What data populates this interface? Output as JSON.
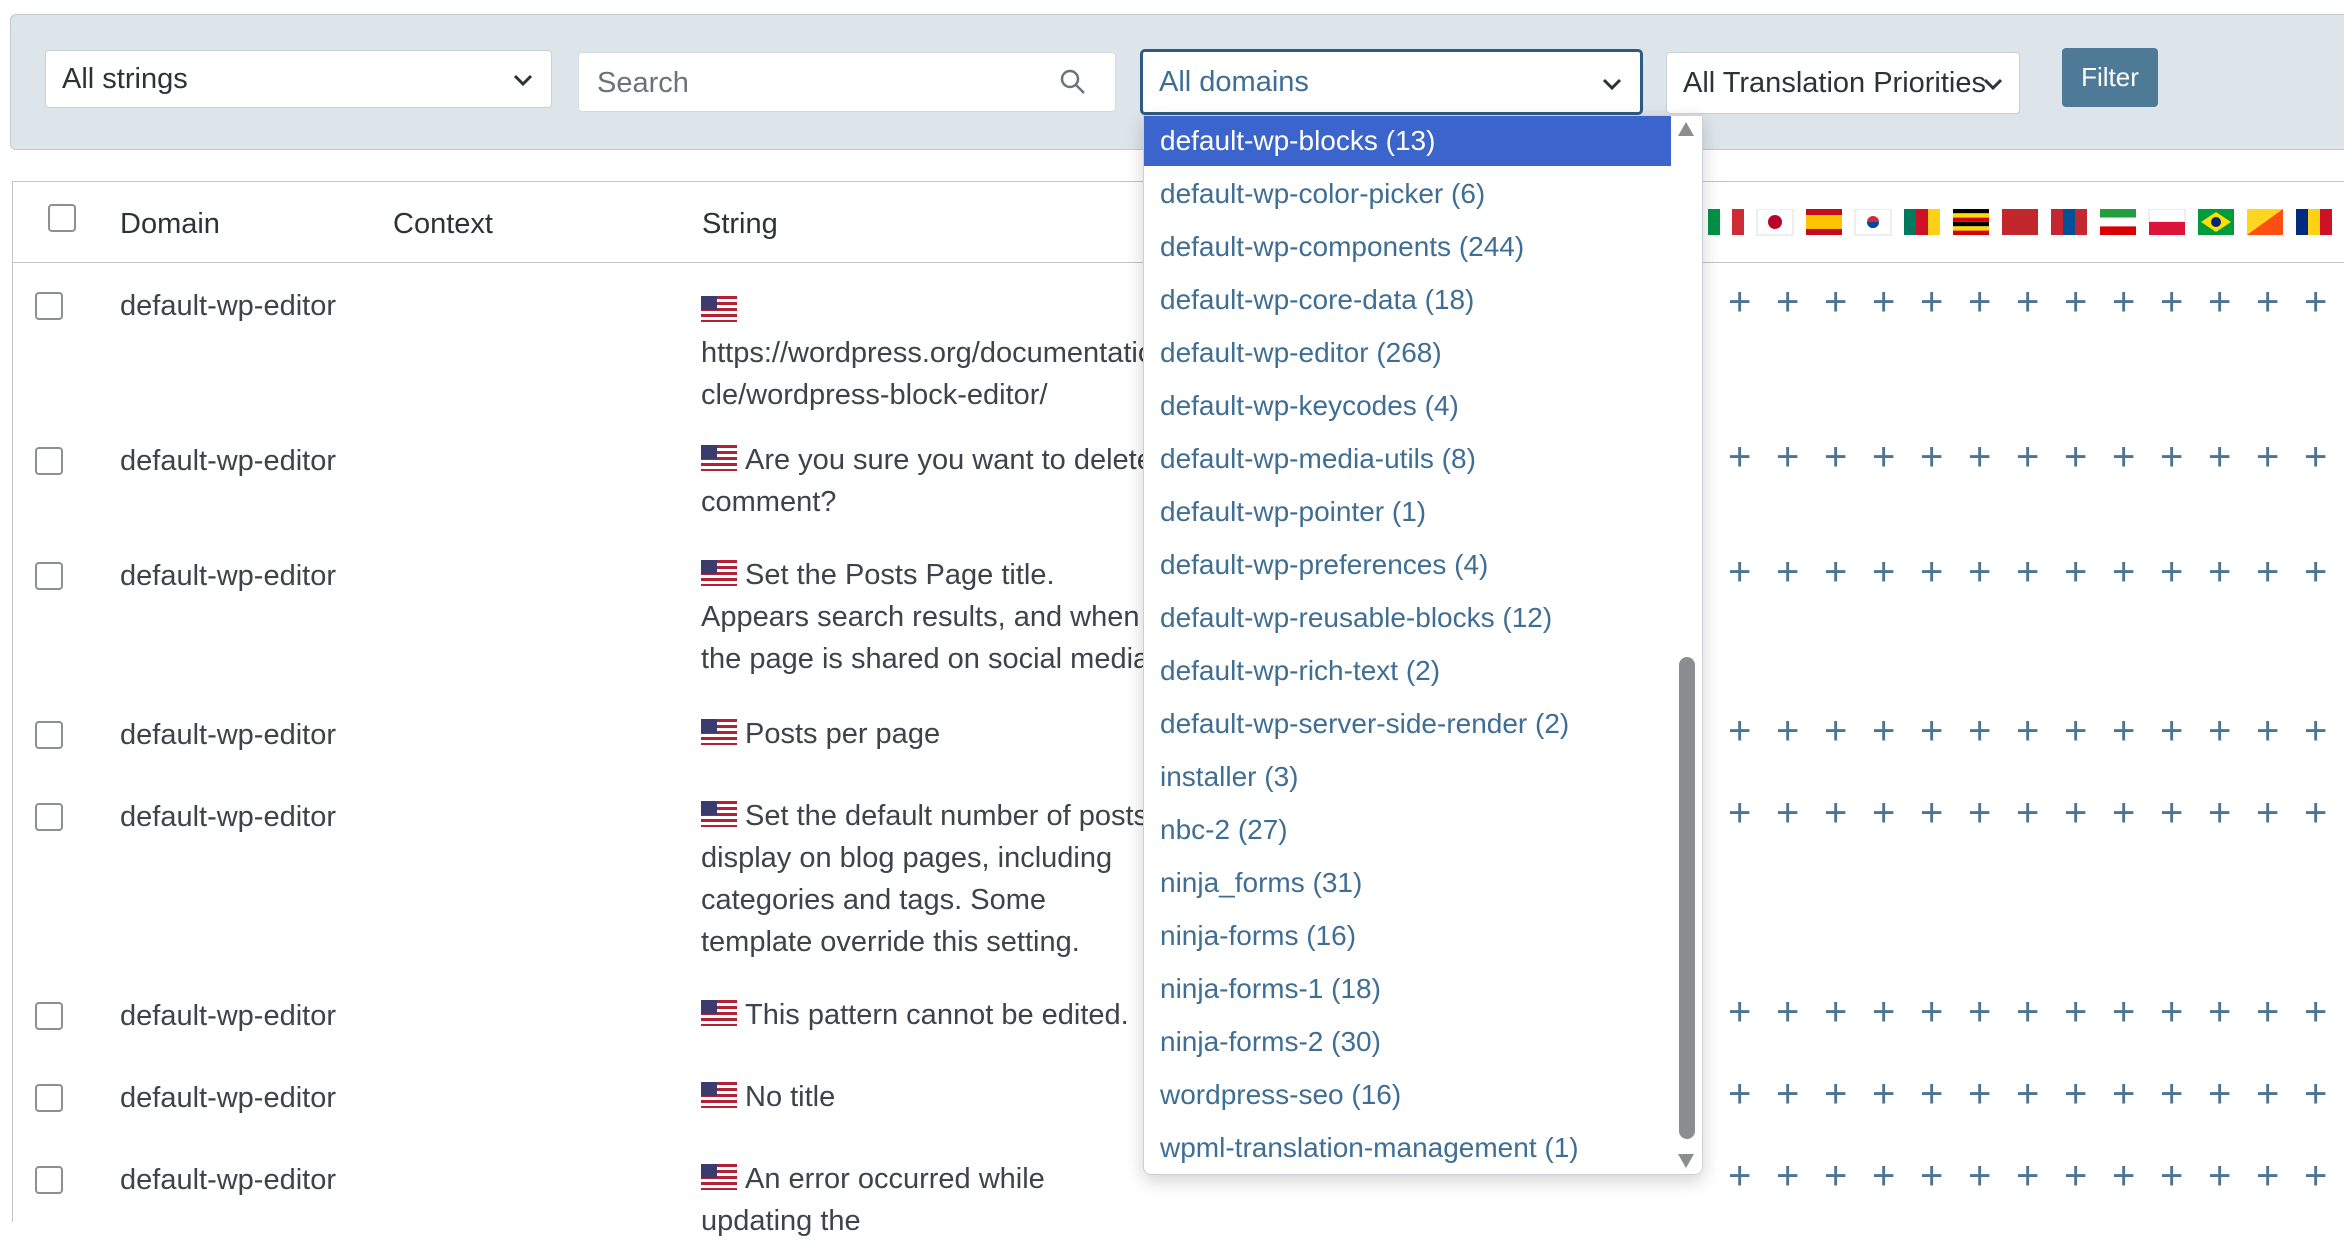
{
  "filters": {
    "strings_select": "All strings",
    "search_placeholder": "Search",
    "domains_select": "All domains",
    "priority_select": "All Translation Priorities",
    "filter_button": "Filter"
  },
  "table": {
    "headers": {
      "domain": "Domain",
      "context": "Context",
      "string": "String"
    },
    "rows": [
      {
        "domain": "default-wp-editor",
        "string": "https://wordpress.org/documentatio cle/wordpress-block-editor/"
      },
      {
        "domain": "default-wp-editor",
        "string": "Are you sure you want to delete comment?"
      },
      {
        "domain": "default-wp-editor",
        "string": "Set the Posts Page title. Appears search results, and when the page is shared on social media."
      },
      {
        "domain": "default-wp-editor",
        "string": "Posts per page"
      },
      {
        "domain": "default-wp-editor",
        "string": "Set the default number of posts display on blog pages, including categories and tags. Some template override this setting."
      },
      {
        "domain": "default-wp-editor",
        "string": "This pattern cannot be edited."
      },
      {
        "domain": "default-wp-editor",
        "string": "No title"
      },
      {
        "domain": "default-wp-editor",
        "string": "An error occurred while updating the"
      }
    ]
  },
  "dropdown": {
    "items": [
      "default-wp-blocks (13)",
      "default-wp-color-picker (6)",
      "default-wp-components (244)",
      "default-wp-core-data (18)",
      "default-wp-editor (268)",
      "default-wp-keycodes (4)",
      "default-wp-media-utils (8)",
      "default-wp-pointer (1)",
      "default-wp-preferences (4)",
      "default-wp-reusable-blocks (12)",
      "default-wp-rich-text (2)",
      "default-wp-server-side-render (2)",
      "installer (3)",
      "nbc-2 (27)",
      "ninja_forms (31)",
      "ninja-forms (16)",
      "ninja-forms-1 (18)",
      "ninja-forms-2 (30)",
      "wordpress-seo (16)",
      "wpml-translation-management (1)"
    ],
    "selected_index": 0
  },
  "colors": {
    "accent": "#3f6e94",
    "selected": "#3b65cc",
    "filter_button": "#4e7a97",
    "filter_bar": "#dde4ea"
  }
}
